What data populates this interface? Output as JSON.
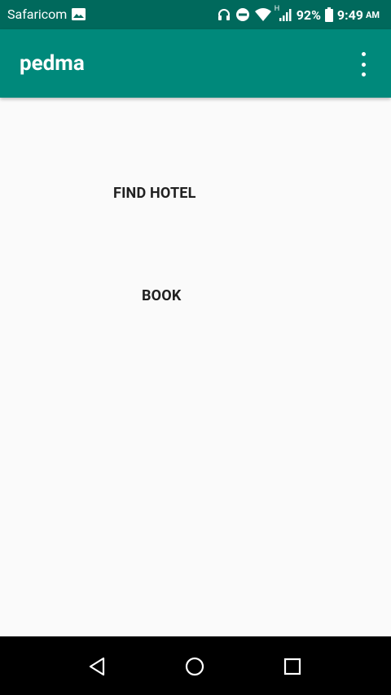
{
  "status_bar": {
    "carrier": "Safaricom",
    "battery": "92%",
    "time": "9:49",
    "ampm": "AM",
    "network_type": "H",
    "icons": [
      "gallery-icon",
      "headphones-icon",
      "do-not-disturb-icon",
      "wifi-icon",
      "signal-icon",
      "battery-icon"
    ]
  },
  "app_bar": {
    "title": "pedma",
    "overflow_icon": "more-vert-icon"
  },
  "main": {
    "find_hotel_label": "FIND HOTEL",
    "book_label": "BOOK"
  },
  "nav_bar": {
    "icons": [
      "back-icon",
      "home-icon",
      "recents-icon"
    ]
  },
  "colors": {
    "status_bar": "#00695c",
    "app_bar": "#00897b",
    "background": "#fafafa",
    "nav_bar": "#000000",
    "button_text": "#212121"
  }
}
